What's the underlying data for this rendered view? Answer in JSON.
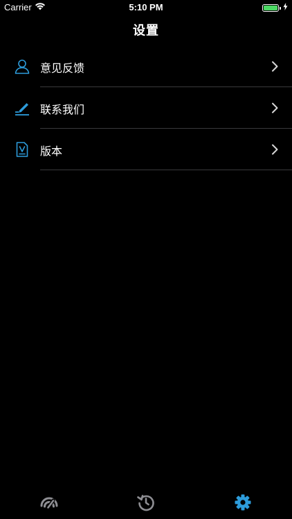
{
  "status_bar": {
    "carrier": "Carrier",
    "time": "5:10 PM",
    "battery_level": 1.0,
    "battery_color": "#4cd964"
  },
  "nav": {
    "title": "设置"
  },
  "settings": {
    "items": [
      {
        "label": "意见反馈",
        "icon": "user-feedback-icon"
      },
      {
        "label": "联系我们",
        "icon": "edit-pencil-icon"
      },
      {
        "label": "版本",
        "icon": "document-version-icon"
      }
    ]
  },
  "tab_bar": {
    "tabs": [
      {
        "icon": "speed-gauge-icon",
        "selected": false
      },
      {
        "icon": "history-icon",
        "selected": false
      },
      {
        "icon": "gear-icon",
        "selected": true
      }
    ],
    "inactive_color": "#8e8e93",
    "active_color": "#2d9cdb"
  },
  "colors": {
    "background": "#000000",
    "accent": "#2d9cdb",
    "divider": "#3a3a3c"
  }
}
